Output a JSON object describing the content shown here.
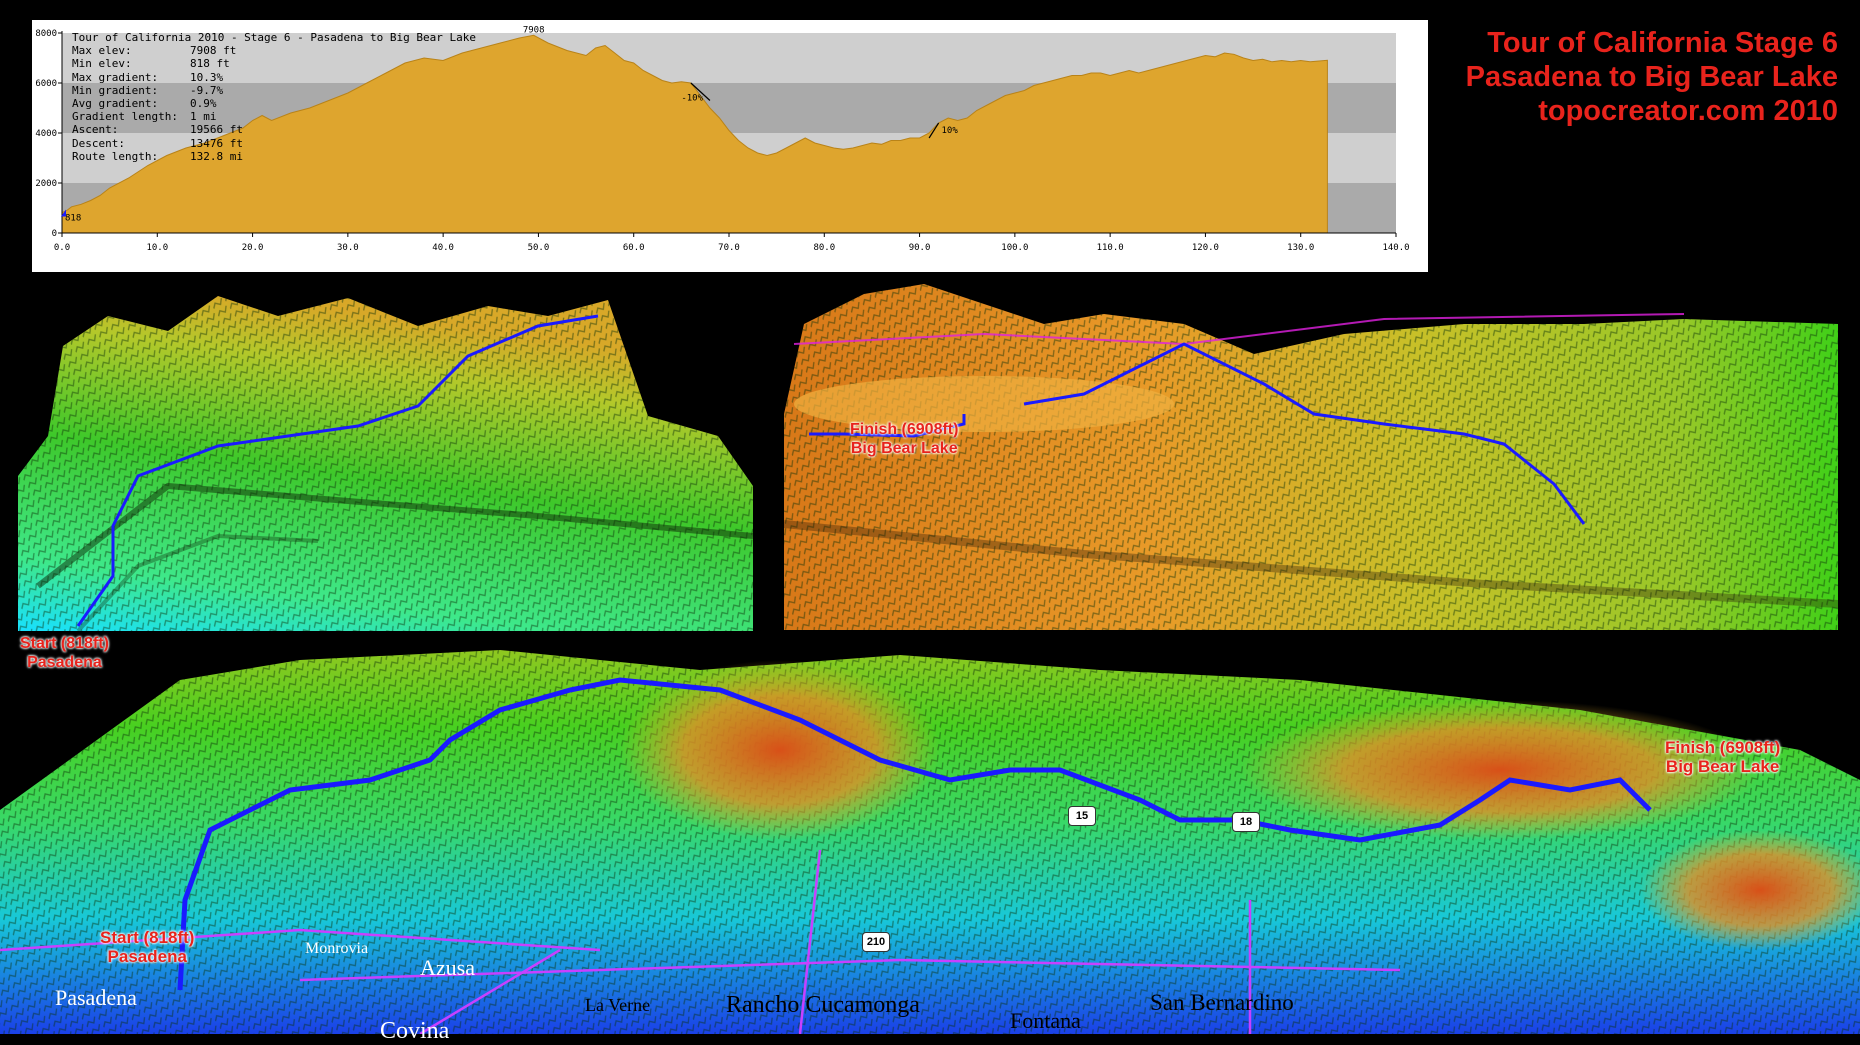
{
  "banner": {
    "line1": "Tour of California Stage 6",
    "line2": "Pasadena to Big Bear Lake",
    "line3": "topocreator.com 2010"
  },
  "profile": {
    "title": "Tour of California 2010 - Stage 6 - Pasadena to Big Bear Lake",
    "stats": [
      {
        "label": "Max elev:",
        "value": "7908 ft"
      },
      {
        "label": "Min elev:",
        "value": "818 ft"
      },
      {
        "label": "Max gradient:",
        "value": "10.3%"
      },
      {
        "label": "Min gradient:",
        "value": "-9.7%"
      },
      {
        "label": "Avg gradient:",
        "value": "0.9%"
      },
      {
        "label": "Gradient length:",
        "value": "1 mi"
      },
      {
        "label": "Ascent:",
        "value": "19566 ft"
      },
      {
        "label": "Descent:",
        "value": "13476 ft"
      },
      {
        "label": "Route length:",
        "value": "132.8 mi"
      }
    ],
    "annotations": {
      "peak": "7908",
      "start": "818",
      "descent": "-10%",
      "climb": "10%"
    },
    "fill_color": "#dea52e"
  },
  "chart_data": {
    "type": "area",
    "title": "Tour of California 2010 - Stage 6 - Pasadena to Big Bear Lake",
    "xlim": [
      0,
      140
    ],
    "ylim": [
      0,
      8000
    ],
    "xticks": [
      "0.0",
      "10.0",
      "20.0",
      "30.0",
      "40.0",
      "50.0",
      "60.0",
      "70.0",
      "80.0",
      "90.0",
      "100.0",
      "110.0",
      "120.0",
      "130.0",
      "140.0"
    ],
    "yticks": [
      "0",
      "2000",
      "4000",
      "6000",
      "8000"
    ],
    "series": [
      {
        "x": [
          0,
          0.5,
          1,
          2,
          3,
          4,
          5,
          7,
          9,
          11,
          13,
          15,
          17,
          19,
          20,
          21,
          22,
          24,
          26,
          28,
          30,
          32,
          34,
          36,
          38,
          40,
          42,
          44,
          46,
          48,
          49.5,
          51,
          53,
          55,
          56,
          57,
          58,
          59,
          60,
          61,
          62,
          63,
          64,
          65,
          66,
          67,
          68,
          69,
          70,
          71,
          72,
          73,
          74,
          75,
          76,
          77,
          78,
          79,
          80,
          81,
          82,
          83,
          84,
          85,
          86,
          87,
          88,
          89,
          90,
          91,
          92,
          93,
          94,
          95,
          96,
          97,
          98,
          99,
          100,
          101,
          102,
          103,
          104,
          105,
          106,
          107,
          108,
          109,
          110,
          111,
          112,
          113,
          114,
          115,
          116,
          117,
          118,
          119,
          120,
          121,
          122,
          123,
          124,
          125,
          126,
          127,
          128,
          129,
          130,
          131,
          132.8
        ],
        "y": [
          818,
          900,
          1050,
          1150,
          1300,
          1500,
          1800,
          2200,
          2700,
          3100,
          3400,
          3600,
          3900,
          4200,
          4500,
          4700,
          4500,
          4800,
          5000,
          5300,
          5600,
          6000,
          6400,
          6800,
          7000,
          6900,
          7200,
          7400,
          7600,
          7800,
          7908,
          7600,
          7300,
          7100,
          7400,
          7500,
          7200,
          6900,
          6800,
          6500,
          6300,
          6100,
          6000,
          6050,
          6000,
          5500,
          5000,
          4600,
          4100,
          3700,
          3400,
          3200,
          3100,
          3200,
          3400,
          3600,
          3800,
          3600,
          3500,
          3400,
          3350,
          3400,
          3500,
          3600,
          3550,
          3700,
          3700,
          3800,
          3800,
          4000,
          4400,
          4600,
          4500,
          4600,
          4900,
          5100,
          5300,
          5500,
          5600,
          5700,
          5900,
          6000,
          6100,
          6200,
          6300,
          6300,
          6400,
          6400,
          6300,
          6400,
          6500,
          6400,
          6500,
          6600,
          6700,
          6800,
          6900,
          7000,
          7100,
          7050,
          7200,
          7150,
          7000,
          6900,
          6950,
          6850,
          6900,
          6850,
          6900,
          6850,
          6908
        ]
      }
    ]
  },
  "maps": {
    "left_callout": {
      "line1": "Start (818ft)",
      "line2": "Pasadena"
    },
    "right_callout": {
      "line1": "Finish (6908ft)",
      "line2": "Big Bear Lake"
    },
    "big_start": {
      "line1": "Start (818ft)",
      "line2": "Pasadena"
    },
    "big_finish": {
      "line1": "Finish (6908ft)",
      "line2": "Big Bear Lake"
    },
    "place_labels": [
      "Monrovia",
      "Azusa",
      "Pasadena",
      "Covina",
      "La Verne",
      "Rancho Cucamonga",
      "Fontana",
      "San Bernardino"
    ],
    "highway_labels": [
      "210",
      "15",
      "18"
    ],
    "route_color": "#1a1aff"
  }
}
